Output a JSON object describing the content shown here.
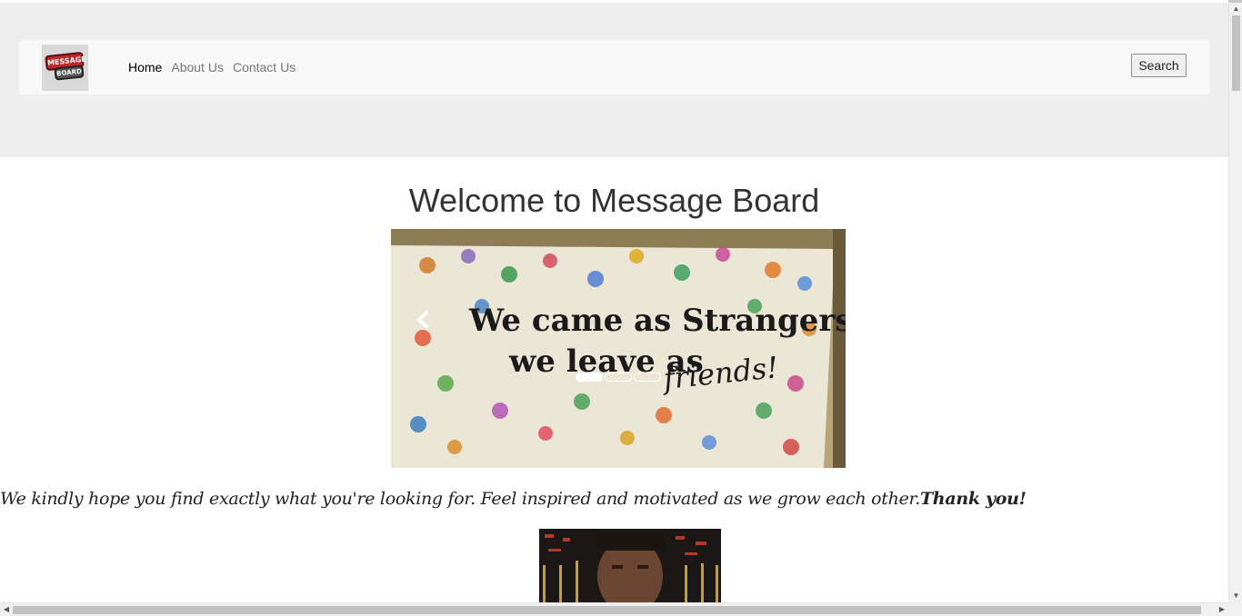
{
  "logo": {
    "line1": "MESSAGE",
    "line2": "BOARD"
  },
  "nav": {
    "links": [
      {
        "label": "Home",
        "active": true
      },
      {
        "label": "About Us",
        "active": false
      },
      {
        "label": "Contact Us",
        "active": false
      }
    ],
    "search_label": "Search"
  },
  "main": {
    "title": "Welcome to Message Board",
    "carousel": {
      "slide_text_line1": "We came as Strangers",
      "slide_text_line2": "we leave as",
      "slide_text_script": "friends!",
      "slide_count": 3,
      "active_slide": 1,
      "prev_icon": "chevron-left-icon"
    },
    "tagline": "We kindly hope you find exactly what you're looking for. Feel inspired and motivated as we grow each other.",
    "tagline_strong": "Thank you!"
  },
  "colors": {
    "header_bg": "#eeeeee",
    "navbar_bg": "#f8f8f8",
    "nav_link": "#777777",
    "nav_active": "#000000"
  }
}
